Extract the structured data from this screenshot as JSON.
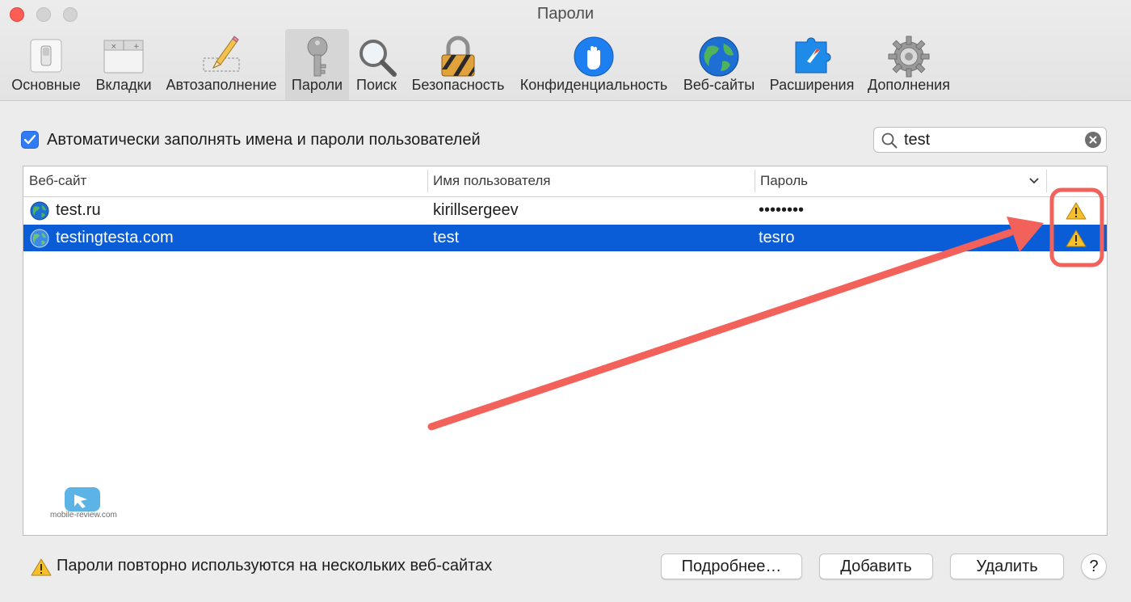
{
  "window": {
    "title": "Пароли"
  },
  "toolbar": {
    "items": [
      {
        "label": "Основные",
        "icon": "general-switch-icon"
      },
      {
        "label": "Вкладки",
        "icon": "tabs-icon"
      },
      {
        "label": "Автозаполнение",
        "icon": "autofill-pencil-icon"
      },
      {
        "label": "Пароли",
        "icon": "key-icon",
        "active": true
      },
      {
        "label": "Поиск",
        "icon": "search-icon"
      },
      {
        "label": "Безопасность",
        "icon": "lock-icon"
      },
      {
        "label": "Конфиденциальность",
        "icon": "privacy-hand-icon"
      },
      {
        "label": "Веб-сайты",
        "icon": "globe-icon"
      },
      {
        "label": "Расширения",
        "icon": "extensions-puzzle-icon"
      },
      {
        "label": "Дополнения",
        "icon": "gear-icon"
      }
    ]
  },
  "autofill_checkbox": {
    "label": "Автоматически заполнять имена и пароли пользователей",
    "checked": true
  },
  "search": {
    "value": "test"
  },
  "table": {
    "headers": {
      "website": "Веб-сайт",
      "username": "Имя пользователя",
      "password": "Пароль"
    },
    "rows": [
      {
        "website": "test.ru",
        "username": "kirillsergeev",
        "password": "••••••••",
        "warning": true,
        "selected": false
      },
      {
        "website": "testingtesta.com",
        "username": "test",
        "password": "tesro",
        "warning": true,
        "selected": true
      }
    ]
  },
  "footer": {
    "warning_text": "Пароли повторно используются на нескольких веб-сайтах",
    "details_button": "Подробнее…",
    "add_button": "Добавить",
    "remove_button": "Удалить",
    "help_button": "?"
  },
  "watermark": {
    "text": "mobile-review.com"
  },
  "colors": {
    "selection": "#0a5cd7",
    "annotation": "#f2625a",
    "checkbox": "#2f7cf6",
    "warning": "#f5c02b"
  }
}
